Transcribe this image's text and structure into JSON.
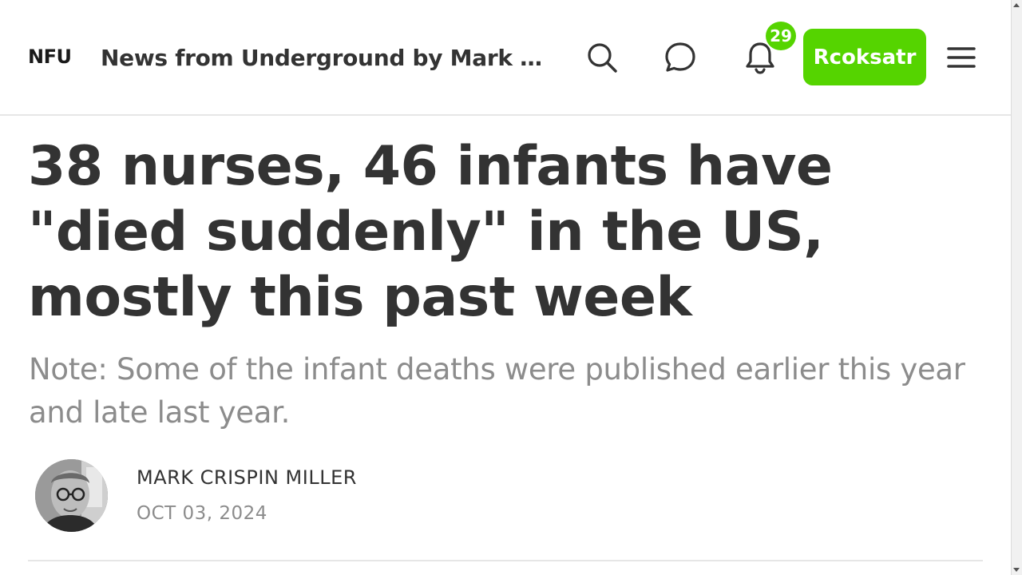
{
  "header": {
    "brand": "NFU",
    "publication_title": "News from Underground by Mark Cr...",
    "notification_count": "29",
    "user_button_label": "Rcoksatr",
    "icons": [
      "search-icon",
      "chat-icon",
      "bell-icon",
      "menu-icon"
    ],
    "accent_color": "#55d400"
  },
  "article": {
    "headline": "38 nurses, 46 infants have \"died suddenly\" in the US, mostly this past week",
    "subtitle": "Note: Some of the infant deaths were published earlier this year and late last year.",
    "author": "MARK CRISPIN MILLER",
    "date": "OCT 03, 2024"
  }
}
